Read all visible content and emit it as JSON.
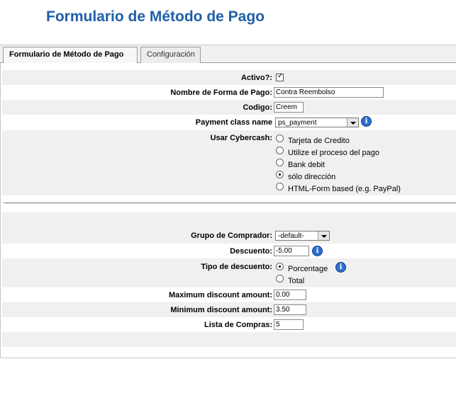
{
  "page": {
    "title": "Formulario de Método de Pago"
  },
  "tabs": [
    {
      "label": "Formulario de Método de Pago",
      "active": true
    },
    {
      "label": "Configuración",
      "active": false
    }
  ],
  "form": {
    "activo": {
      "label": "Activo?:",
      "checked": true
    },
    "nombre": {
      "label": "Nombre de Forma de Pago:",
      "value": "Contra Reembolso"
    },
    "codigo": {
      "label": "Codigo:",
      "value": "Creem"
    },
    "payment_class": {
      "label": "Payment class name",
      "value": "ps_payment"
    },
    "cybercash": {
      "label": "Usar Cybercash:",
      "options": [
        "Tarjeta de Credito",
        "Utilize el proceso del pago",
        "Bank debit",
        "sólo dirección",
        "HTML-Form based (e.g. PayPal)"
      ],
      "selected_index": 3
    },
    "grupo": {
      "label": "Grupo de Comprador:",
      "value": "-default-"
    },
    "descuento": {
      "label": "Descuento:",
      "value": "-5.00"
    },
    "tipo_descuento": {
      "label": "Tipo de descuento:",
      "options": [
        "Porcentage",
        "Total"
      ],
      "selected_index": 0
    },
    "max_discount": {
      "label": "Maximum discount amount:",
      "value": "0.00"
    },
    "min_discount": {
      "label": "Minimum discount amount:",
      "value": "3.50"
    },
    "lista_compras": {
      "label": "Lista de Compras:",
      "value": "5"
    }
  },
  "icons": {
    "info": "info-icon",
    "checkmark": "✓"
  },
  "colors": {
    "title": "#1f5fa8",
    "row_shade": "#f0f0f0",
    "info_icon": "#2f6fd0"
  }
}
